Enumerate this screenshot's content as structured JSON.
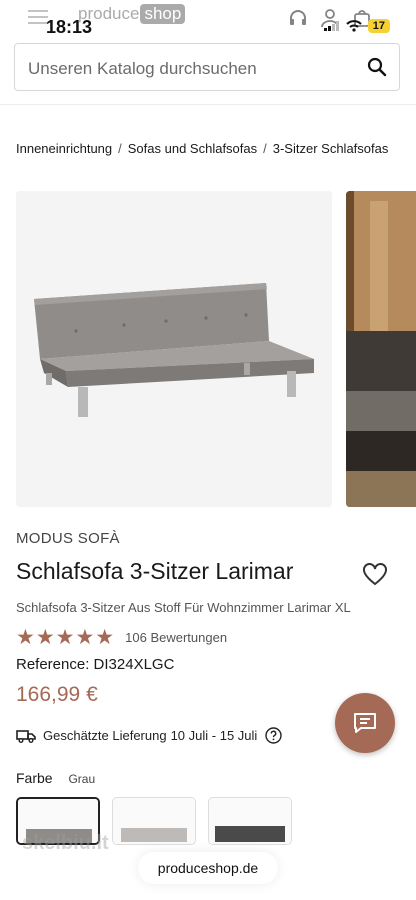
{
  "status": {
    "time": "18:13",
    "battery": "17"
  },
  "header": {
    "logo_part1": "produce",
    "logo_part2": "shop"
  },
  "search": {
    "placeholder": "Unseren Katalog durchsuchen"
  },
  "breadcrumb": {
    "items": [
      "Inneneinrichtung",
      "Sofas und Schlafsofas",
      "3-Sitzer Schlafsofas"
    ],
    "separator": "/"
  },
  "product": {
    "brand": "MODUS SOFÀ",
    "title": "Schlafsofa 3-Sitzer Larimar",
    "subtitle": "Schlafsofa 3-Sitzer Aus Stoff Für Wohnzimmer Larimar XL",
    "rating": 5,
    "rating_max": 5,
    "reviews": "106 Bewertungen",
    "reference": "Reference: DI324XLGC",
    "price": "166,99 €"
  },
  "delivery": {
    "label": "Geschätzte Lieferung",
    "dates": "10 Juli - 15 Juli"
  },
  "color": {
    "label": "Farbe",
    "value": "Grau"
  },
  "footer": {
    "url": "produceshop.de",
    "watermark": "skelbiu.lt"
  },
  "colors": {
    "accent": "#a46a56",
    "sofa_grey": "#8e8b88",
    "dark_grey": "#4a4a4a"
  }
}
